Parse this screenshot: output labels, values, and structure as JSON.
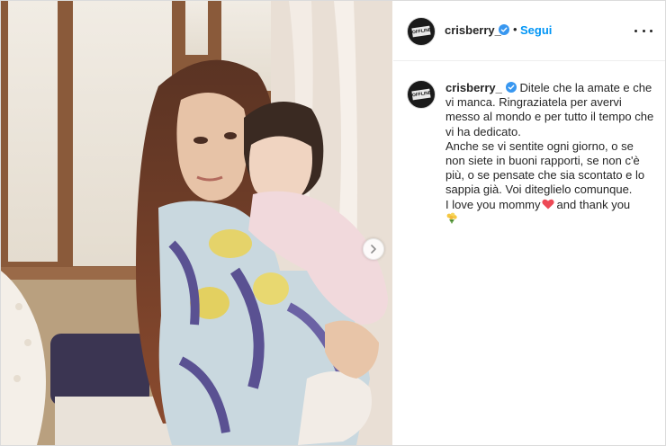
{
  "post": {
    "username": "crisberry_",
    "follow_label": "Segui",
    "dot": "•",
    "avatar_text": "OFFLINE"
  },
  "caption": {
    "username": "crisberry_",
    "text_first": "Ditele che la amate e che vi manca. Ringraziatela per avervi messo al mondo e per tutto il tempo che vi ha dedicato.",
    "text_second": "Anche se vi sentite ogni giorno, o se non siete in buoni rapporti, se non c'è più, o se pensate che sia scontato e lo sappia già. Voi diteglielo comunque.",
    "text_third_before": "I love you mommy",
    "text_third_after": "and thank you"
  },
  "colors": {
    "link_blue": "#0095f6",
    "verified_blue": "#3897f0",
    "text": "#262626",
    "heart_red": "#ed4956"
  },
  "icons": {
    "verified": "verified-badge-icon",
    "more": "more-horizontal-icon",
    "next": "chevron-right-icon",
    "heart": "red-heart-emoji",
    "bouquet": "bouquet-emoji"
  }
}
